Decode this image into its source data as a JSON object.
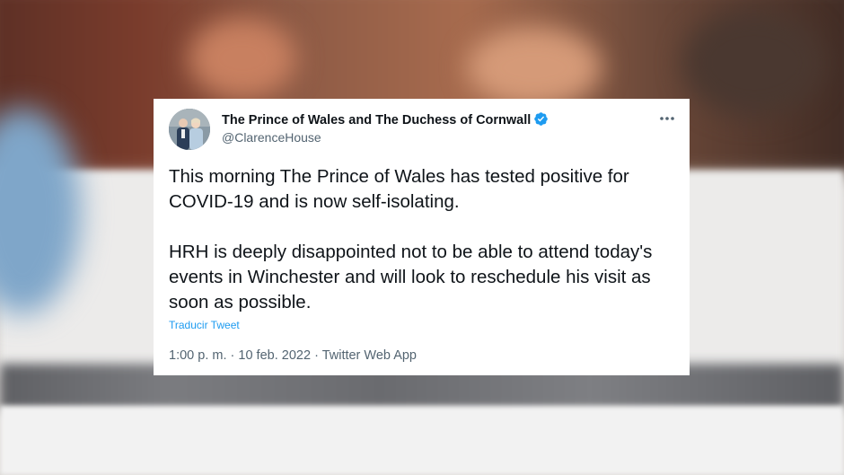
{
  "tweet": {
    "author_name": "The Prince of Wales and The Duchess of Cornwall",
    "author_handle": "@ClarenceHouse",
    "verified": true,
    "paragraphs": [
      "This morning The Prince of Wales has tested positive for COVID-19 and is now self-isolating.",
      "HRH is deeply disappointed not to be able to attend today's events in Winchester and will look to reschedule his visit as soon as possible."
    ],
    "translate_label": "Traducir Tweet",
    "time": "1:00 p. m.",
    "date": "10 feb. 2022",
    "source": "Twitter Web App",
    "separator": "·"
  },
  "icons": {
    "more": "more-horizontal-icon",
    "verified": "verified-badge-icon",
    "avatar": "profile-avatar"
  },
  "colors": {
    "verified": "#1d9bf0",
    "link": "#1d9bf0",
    "secondary_text": "#536471",
    "primary_text": "#0f1419",
    "card_background": "#ffffff"
  }
}
